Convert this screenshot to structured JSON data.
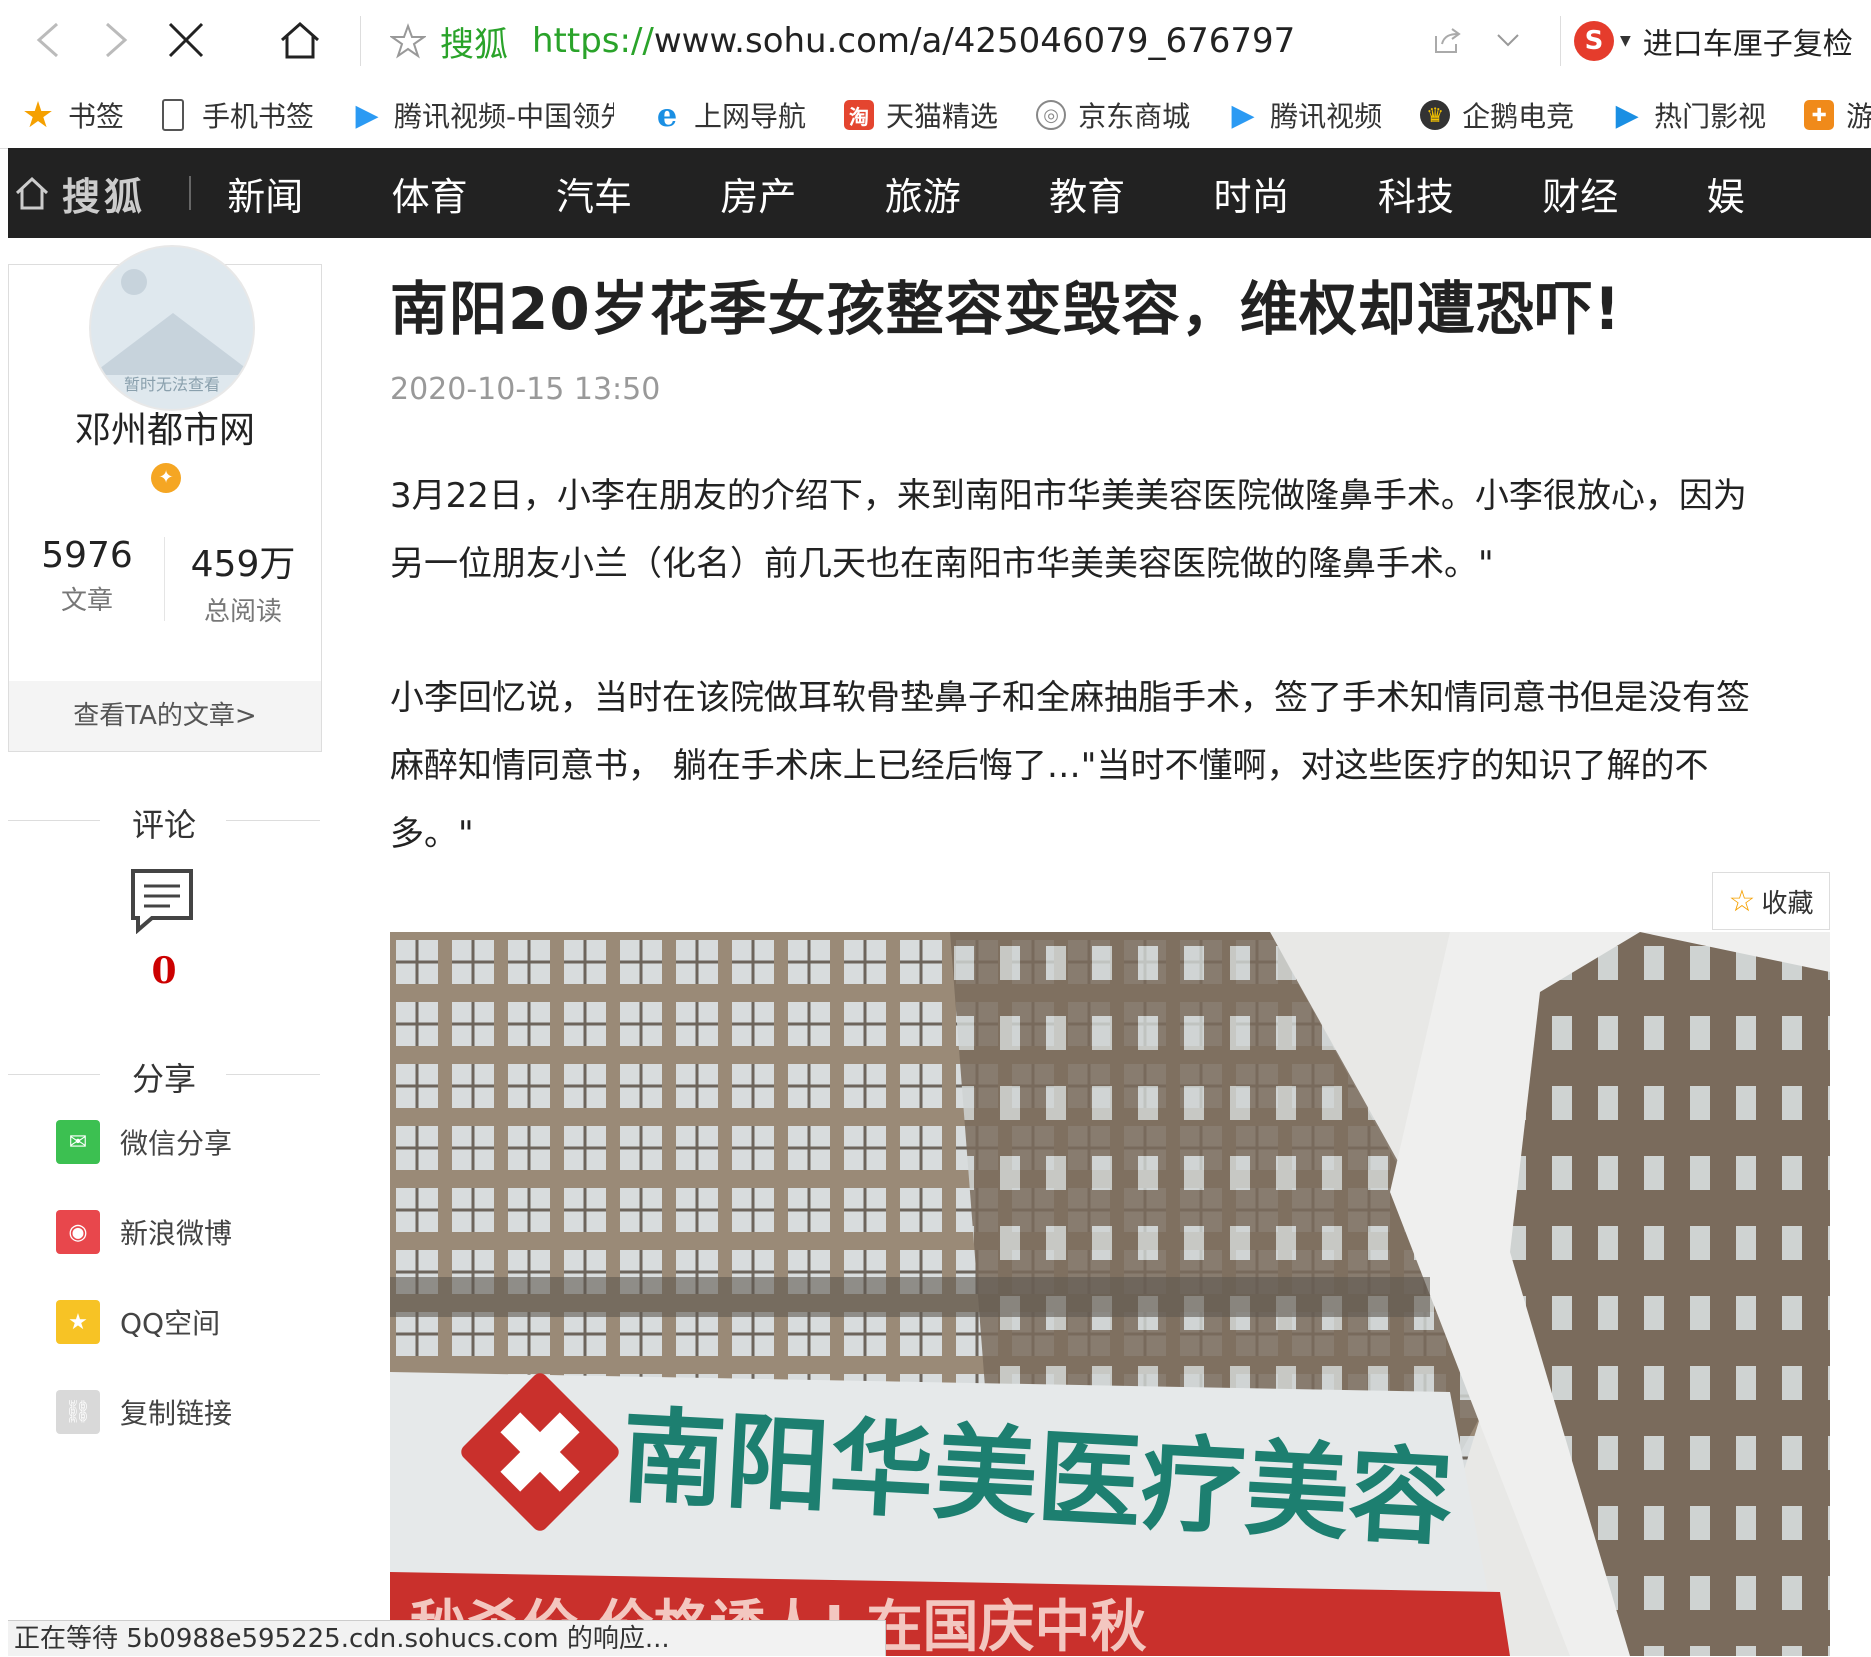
{
  "browser": {
    "site_name": "搜狐",
    "url_protocol": "https://",
    "url_rest": "www.sohu.com/a/425046079_676797",
    "search_text": "进口车厘子复检"
  },
  "bookmarks": [
    {
      "label": "书签",
      "icon": "star-icon"
    },
    {
      "label": "手机书签",
      "icon": "phone-icon"
    },
    {
      "label": "腾讯视频-中国领先",
      "icon": "tencent-video-icon"
    },
    {
      "label": "上网导航",
      "icon": "ie-icon"
    },
    {
      "label": "天猫精选",
      "icon": "tmall-icon"
    },
    {
      "label": "京东商城",
      "icon": "globe-icon"
    },
    {
      "label": "腾讯视频",
      "icon": "tencent-video-icon"
    },
    {
      "label": "企鹅电竞",
      "icon": "penguin-icon"
    },
    {
      "label": "热门影视",
      "icon": "play-icon"
    },
    {
      "label": "游戏",
      "icon": "gamepad-icon"
    }
  ],
  "sohu_nav": {
    "logo": "搜狐",
    "items": [
      "新闻",
      "体育",
      "汽车",
      "房产",
      "旅游",
      "教育",
      "时尚",
      "科技",
      "财经",
      "娱"
    ]
  },
  "profile": {
    "avatar_text": "暂时无法查看",
    "name": "邓州都市网",
    "articles_count": "5976",
    "articles_label": "文章",
    "reads_count": "459万",
    "reads_label": "总阅读",
    "view_more": "查看TA的文章>"
  },
  "comments": {
    "title": "评论",
    "count": "0"
  },
  "share": {
    "title": "分享",
    "items": [
      {
        "label": "微信分享",
        "color": "#3cc051"
      },
      {
        "label": "新浪微博",
        "color": "#e8474c"
      },
      {
        "label": "QQ空间",
        "color": "#f7c325"
      },
      {
        "label": "复制链接",
        "color": "#d9d9d9"
      }
    ]
  },
  "article": {
    "title": "南阳20岁花季女孩整容变毁容，维权却遭恐吓!",
    "date": "2020-10-15 13:50",
    "p1_l1": "3月22日，小李在朋友的介绍下，来到南阳市华美美容医院做隆鼻手术。小李很放心，因为",
    "p1_l2": "另一位朋友小兰（化名）前几天也在南阳市华美美容医院做的隆鼻手术。\"",
    "p2_l1": "小李回忆说，当时在该院做耳软骨垫鼻子和全麻抽脂手术，签了手术知情同意书但是没有签",
    "p2_l2": "麻醉知情同意书， 躺在手术床上已经后悔了…\"当时不懂啊，对这些医疗的知识了解的不",
    "p2_l3": "多。\"",
    "favorite": "收藏",
    "photo_sign": "南阳华美医疗美容",
    "photo_banner": "秒杀价  价格诱人! 在国庆中秋"
  },
  "status_text": "正在等待 5b0988e595225.cdn.sohucs.com 的响应..."
}
